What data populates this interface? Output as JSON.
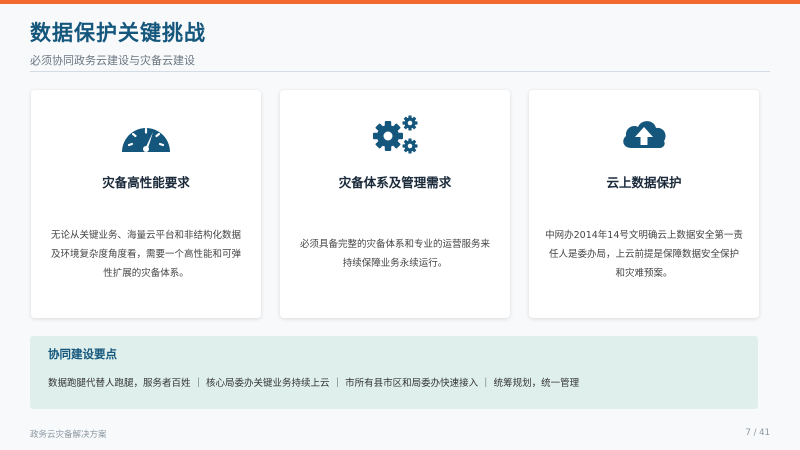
{
  "header": {
    "title": "数据保护关键挑战",
    "subtitle": "必须协同政务云建设与灾备云建设"
  },
  "colors": {
    "accent": "#f26a2e",
    "primary": "#14567c",
    "highlight_bg": "#dff0ec"
  },
  "cards": [
    {
      "icon": "speedometer-icon",
      "title": "灾备高性能要求",
      "desc": "无论从关键业务、海量云平台和非结构化数据及环境复杂度角度看，需要一个高性能和可弹性扩展的灾备体系。"
    },
    {
      "icon": "gears-icon",
      "title": "灾备体系及管理需求",
      "desc": "必须具备完整的灾备体系和专业的运营服务来持续保障业务永续运行。"
    },
    {
      "icon": "cloud-upload-icon",
      "title": "云上数据保护",
      "desc": "中网办2014年14号文明确云上数据安全第一责任人是委办局，上云前提是保障数据安全保护和灾难预案。"
    }
  ],
  "key_points": {
    "title": "协同建设要点",
    "text": "数据跑腿代替人跑腿，服务者百姓 ｜ 核心局委办关键业务持续上云 ｜ 市所有县市区和局委办快速接入 ｜ 统筹规划，统一管理"
  },
  "footer": {
    "left": "政务云灾备解决方案",
    "page": "7 / 41"
  }
}
